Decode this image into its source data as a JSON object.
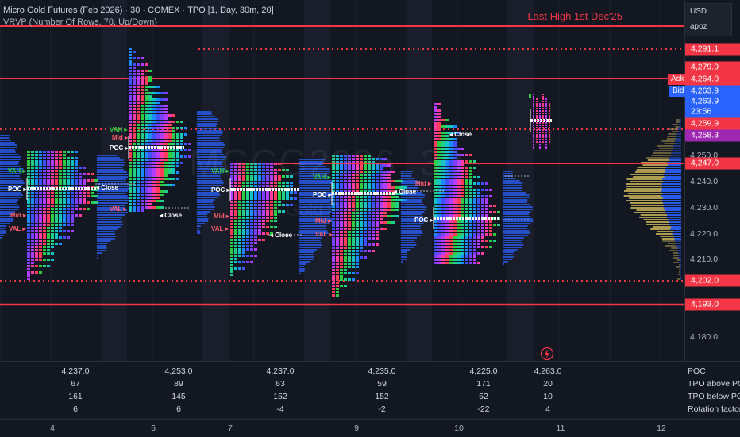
{
  "header": {
    "title": "Micro Gold Futures (Feb 2026) · 30 · COMEX · TPO [1, Day, 30m, 20]",
    "indicator": "VRVP (Number Of Rows, 70, Up/Down)"
  },
  "annotation_last_high": "Last High 1st Dec'25",
  "watermark": {
    "symbol": "MGCG2026, 30",
    "name": "Micro Gold Futures"
  },
  "currency_menu": {
    "currency": "USD",
    "unit": "apoz"
  },
  "price_axis": {
    "ticks": [
      "4,250.0",
      "4,240.0",
      "4,230.0",
      "4,220.0",
      "4,210.0",
      "4,180.0"
    ],
    "labels": [
      {
        "text": "4,291.1",
        "color": "#f23645"
      },
      {
        "text": "4,279.9",
        "color": "#f23645"
      },
      {
        "text": "4,264.0",
        "color": "#f23645"
      },
      {
        "text": "4,263.9",
        "color": "#2962ff"
      },
      {
        "text": "4,263.9",
        "color": "#2962ff"
      },
      {
        "text": "23:56",
        "color": "#2962ff"
      },
      {
        "text": "4,259.9",
        "color": "#f23645"
      },
      {
        "text": "4,258.3",
        "color": "#9c27b0"
      },
      {
        "text": "4,247.0",
        "color": "#f23645"
      },
      {
        "text": "4,202.0",
        "color": "#f23645"
      },
      {
        "text": "4,193.0",
        "color": "#f23645"
      }
    ],
    "ask_label": "Ask",
    "bid_label": "Bid"
  },
  "profile_labels": {
    "vah": "VAH",
    "mid": "Mid",
    "poc": "POC",
    "val": "VAL",
    "close": "Close"
  },
  "stats_table": {
    "row_labels": [
      "POC",
      "TPO above POC",
      "TPO below POC",
      "Rotation factor"
    ],
    "columns": [
      {
        "poc": "4,237.0",
        "above": "67",
        "below": "161",
        "rotation": "6"
      },
      {
        "poc": "4,253.0",
        "above": "89",
        "below": "145",
        "rotation": "6"
      },
      {
        "poc": "4,237.0",
        "above": "63",
        "below": "152",
        "rotation": "-4"
      },
      {
        "poc": "4,235.0",
        "above": "59",
        "below": "152",
        "rotation": "-2"
      },
      {
        "poc": "4,225.0",
        "above": "171",
        "below": "52",
        "rotation": "-22"
      },
      {
        "poc": "4,263.0",
        "above": "20",
        "below": "10",
        "rotation": "4"
      }
    ]
  },
  "time_axis": [
    "4",
    "5",
    "7",
    "9",
    "10",
    "11",
    "12"
  ],
  "colors": {
    "background": "#131722",
    "level_red": "#f23645",
    "bid_blue": "#2962ff",
    "vp_yellow": "#c9b458",
    "vp_blue": "#2962ff"
  }
}
